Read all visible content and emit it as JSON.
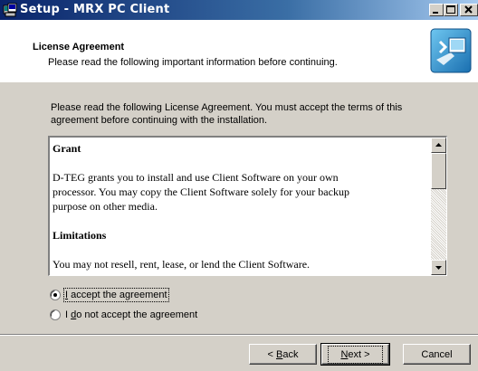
{
  "window": {
    "title": "Setup - MRX PC Client",
    "icons": {
      "app": "setup-app-icon",
      "minimize": "minimize-icon",
      "maximize": "maximize-icon",
      "close": "close-icon"
    }
  },
  "header": {
    "title": "License Agreement",
    "subtitle": "Please read the following important information before continuing.",
    "image_icon": "computer-wizard-icon"
  },
  "intro": {
    "line1": "Please read the following License Agreement. You must accept the terms of this",
    "line2": "agreement before continuing with the installation."
  },
  "license": {
    "heading1": "Grant",
    "para1_line1": "D-TEG grants you to install and use Client Software on your own",
    "para1_line2": "processor. You may copy the Client Software solely for your backup",
    "para1_line3": "purpose on other media.",
    "heading2": "Limitations",
    "para2_line1": "You may not resell, rent, lease, or lend the Client Software."
  },
  "options": {
    "accept": {
      "pre": "",
      "mnemonic": "I",
      "post": " accept the agreement",
      "selected": true
    },
    "decline": {
      "pre": "I ",
      "mnemonic": "d",
      "post": "o not accept the agreement",
      "selected": false
    }
  },
  "buttons": {
    "back": {
      "pre": "< ",
      "mnemonic": "B",
      "post": "ack"
    },
    "next": {
      "pre": "",
      "mnemonic": "N",
      "post": "ext >"
    },
    "cancel": "Cancel"
  }
}
